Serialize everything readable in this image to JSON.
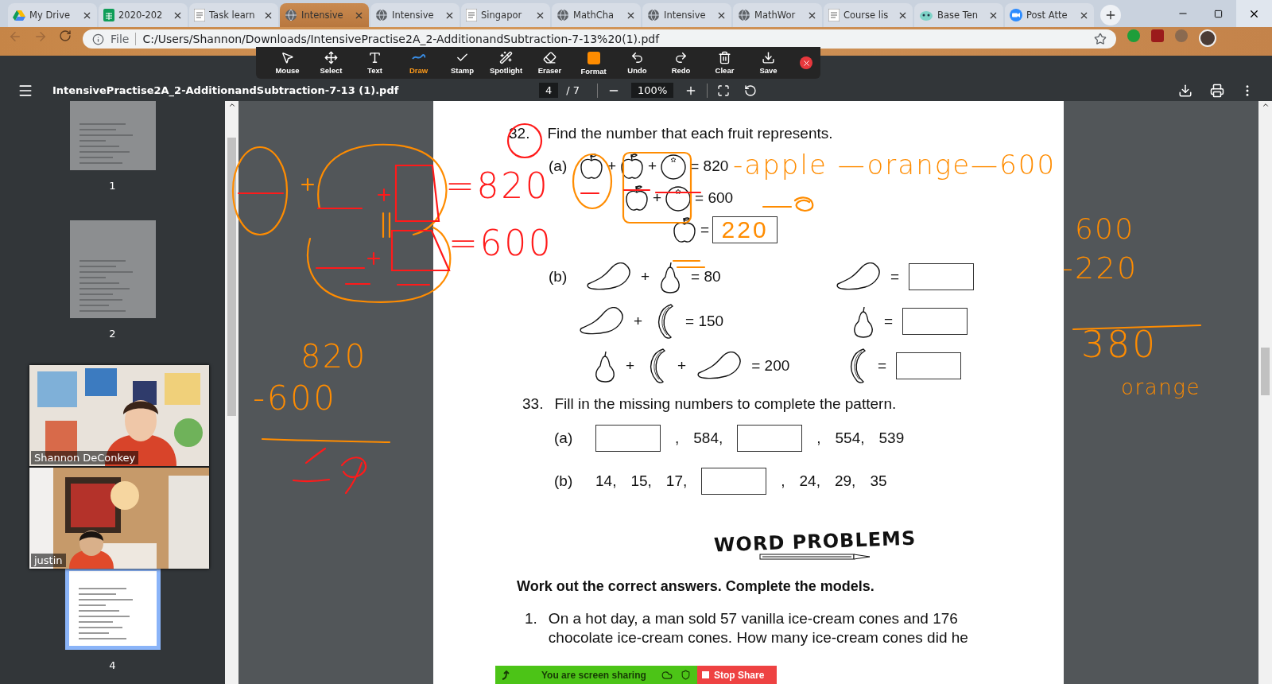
{
  "browser": {
    "tabs": [
      {
        "kind": "drive",
        "title": "My Drive",
        "selected": false
      },
      {
        "kind": "sheet",
        "title": "2020-202",
        "selected": false
      },
      {
        "kind": "doc",
        "title": "Task learn",
        "selected": false
      },
      {
        "kind": "globe",
        "title": "Intensive",
        "selected": true
      },
      {
        "kind": "globe",
        "title": "Intensive",
        "selected": false
      },
      {
        "kind": "doc",
        "title": "Singapor",
        "selected": false
      },
      {
        "kind": "globe",
        "title": "MathCha",
        "selected": false
      },
      {
        "kind": "globe",
        "title": "Intensive",
        "selected": false
      },
      {
        "kind": "globe",
        "title": "MathWor",
        "selected": false
      },
      {
        "kind": "doc",
        "title": "Course lis",
        "selected": false
      },
      {
        "kind": "bot",
        "title": "Base Ten",
        "selected": false
      },
      {
        "kind": "video",
        "title": "Post Atte",
        "selected": false
      }
    ],
    "address": {
      "scheme": "File",
      "url": "C:/Users/Shannon/Downloads/IntensivePractise2A_2-AdditionandSubtraction-7-13%20(1).pdf"
    }
  },
  "pdf_toolbar": {
    "title": "IntensivePractise2A_2-AdditionandSubtraction-7-13 (1).pdf",
    "page": "4",
    "page_count": "/ 7",
    "zoom": "100%"
  },
  "annotate_toolbar": {
    "tools": [
      {
        "label": "Mouse",
        "selected": false
      },
      {
        "label": "Select",
        "selected": false
      },
      {
        "label": "Text",
        "selected": false
      },
      {
        "label": "Draw",
        "selected": true
      },
      {
        "label": "Stamp",
        "selected": false
      },
      {
        "label": "Spotlight",
        "selected": false
      },
      {
        "label": "Eraser",
        "selected": false
      },
      {
        "label": "Format",
        "selected": false
      },
      {
        "label": "Undo",
        "selected": false
      },
      {
        "label": "Redo",
        "selected": false
      },
      {
        "label": "Clear",
        "selected": false
      },
      {
        "label": "Save",
        "selected": false
      }
    ]
  },
  "sidebar": {
    "thumbnails": [
      {
        "label": "1",
        "selected": false
      },
      {
        "label": "2",
        "selected": false
      },
      {
        "label": "4",
        "selected": true
      }
    ]
  },
  "video_panel": [
    {
      "name": "Shannon DeConkey"
    },
    {
      "name": "justin"
    }
  ],
  "page": {
    "question_32": {
      "number": "32.",
      "prompt": "Find the number that each fruit represents.",
      "part_a": {
        "label": "(a)",
        "equations": [
          {
            "terms": [
              {
                "kind": "apple"
              },
              {
                "kind": "text",
                "text": "+"
              },
              {
                "kind": "apple"
              },
              {
                "kind": "text",
                "text": "+"
              },
              {
                "kind": "orange"
              },
              {
                "kind": "text",
                "text": "= 820"
              }
            ]
          },
          {
            "terms": [
              {
                "kind": "apple"
              },
              {
                "kind": "text",
                "text": "+"
              },
              {
                "kind": "orange"
              },
              {
                "kind": "text",
                "text": "= 600"
              }
            ]
          },
          {
            "terms": [
              {
                "kind": "apple"
              },
              {
                "kind": "text",
                "text": "="
              },
              {
                "kind": "answer",
                "value": "220"
              }
            ]
          }
        ]
      },
      "part_b": {
        "label": "(b)",
        "equations": [
          [
            {
              "kind": "mango"
            },
            {
              "kind": "text",
              "text": "+"
            },
            {
              "kind": "pear"
            },
            {
              "kind": "text",
              "text": "= 80"
            }
          ],
          [
            {
              "kind": "mango"
            },
            {
              "kind": "text",
              "text": "+"
            },
            {
              "kind": "banana"
            },
            {
              "kind": "text",
              "text": "= 150"
            }
          ],
          [
            {
              "kind": "pear"
            },
            {
              "kind": "text",
              "text": "+"
            },
            {
              "kind": "banana"
            },
            {
              "kind": "text",
              "text": "+"
            },
            {
              "kind": "mango"
            },
            {
              "kind": "text",
              "text": "= 200"
            }
          ]
        ],
        "answers": [
          [
            {
              "kind": "mango"
            },
            {
              "kind": "text",
              "text": "="
            },
            {
              "kind": "answer"
            }
          ],
          [
            {
              "kind": "pear"
            },
            {
              "kind": "text",
              "text": "="
            },
            {
              "kind": "answer"
            }
          ],
          [
            {
              "kind": "banana"
            },
            {
              "kind": "text",
              "text": "="
            },
            {
              "kind": "answer"
            }
          ]
        ]
      }
    },
    "question_33": {
      "number": "33.",
      "prompt": "Fill in the missing numbers to complete the pattern.",
      "parts": [
        {
          "label": "(a)",
          "items": [
            {
              "kind": "answer"
            },
            {
              "kind": "text",
              "text": ","
            },
            {
              "kind": "text",
              "text": "584,"
            },
            {
              "kind": "answer"
            },
            {
              "kind": "text",
              "text": ","
            },
            {
              "kind": "text",
              "text": "554,"
            },
            {
              "kind": "text",
              "text": "539"
            }
          ]
        },
        {
          "label": "(b)",
          "items": [
            {
              "kind": "text",
              "text": "14,"
            },
            {
              "kind": "text",
              "text": "15,"
            },
            {
              "kind": "text",
              "text": "17,"
            },
            {
              "kind": "answer"
            },
            {
              "kind": "text",
              "text": ","
            },
            {
              "kind": "text",
              "text": "24,"
            },
            {
              "kind": "text",
              "text": "29,"
            },
            {
              "kind": "text",
              "text": "35"
            }
          ]
        }
      ]
    },
    "word_problems": {
      "heading": "WORD PROBLEMS",
      "instruction": "Work out the correct answers. Complete the models.",
      "problems": [
        {
          "number": "1.",
          "text": "On a hot day, a man sold 57 vanilla ice-cream cones and 176 chocolate ice-cream cones. How many ice-cream cones did he"
        }
      ]
    }
  },
  "annotations": [
    {
      "text": "=820",
      "color": "#ff1a1a"
    },
    {
      "text": "=600",
      "color": "#ff1a1a"
    },
    {
      "text": "-apple —orange—600",
      "color": "#ff8c00"
    },
    {
      "text": "820",
      "color": "#ff8c00"
    },
    {
      "text": "-600",
      "color": "#ff8c00"
    },
    {
      "text": "600",
      "color": "#ff8c00"
    },
    {
      "text": "-220",
      "color": "#ff8c00"
    },
    {
      "text": "380",
      "color": "#ff8c00"
    },
    {
      "text": "orange",
      "color": "#ff8c00"
    }
  ],
  "share_bar": {
    "status": "You are screen sharing",
    "button": "Stop Share"
  }
}
